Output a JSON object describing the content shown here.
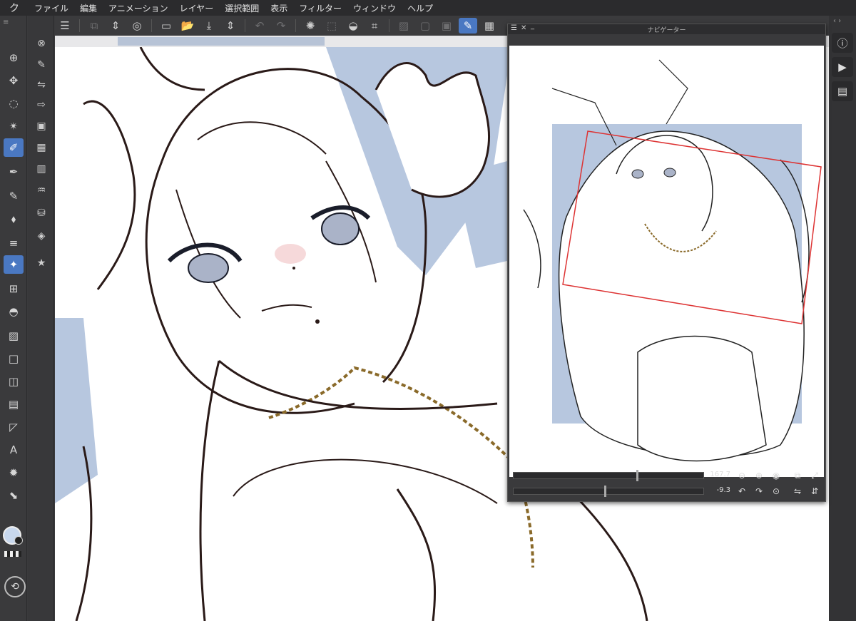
{
  "menubar": {
    "logo": "ク",
    "items": [
      "ファイル",
      "編集",
      "アニメーション",
      "レイヤー",
      "選択範囲",
      "表示",
      "フィルター",
      "ウィンドウ",
      "ヘルプ"
    ]
  },
  "toolbar": {
    "menu_icon": "☰",
    "new_icon": "⧉",
    "updown_icon": "⇕",
    "sync_icon": "◎",
    "doc_icon": "▭",
    "open_icon": "📂",
    "save_icon": "⤓",
    "undo_icon": "↶",
    "redo_icon": "↷",
    "spin_icon": "✺",
    "transform_icon": "⬚",
    "fill_icon": "◒",
    "crop_icon": "⌗",
    "a1": "▨",
    "a2": "▢",
    "a3": "▣",
    "pen_active": "✎",
    "grid_icon": "▦"
  },
  "tools": {
    "header": "≡",
    "items": [
      "⊕",
      "✥",
      "◌",
      "✴",
      "✐",
      "✒",
      "✎",
      "⬧",
      "≡",
      "✦",
      "⊞",
      "◓",
      "▨",
      "□",
      "◫",
      "▤",
      "◸",
      "A",
      "✹",
      "⬊"
    ],
    "rotate_icon": "⟲"
  },
  "subtools": {
    "items": [
      "⊗",
      "✎",
      "⇋",
      "⇨",
      "▣",
      "▦",
      "▥",
      "♒",
      "⛁",
      "◈",
      "★"
    ]
  },
  "rightbar": {
    "collapse": "‹ ›",
    "info_icon": "ⓘ",
    "anim_icon": "▶",
    "layer_icon": "▤"
  },
  "navigator": {
    "title": "ナビゲーター",
    "menu_icon": "☰",
    "close_icon": "✕",
    "min_icon": "_",
    "zoom_value": "167.7",
    "rotate_value": "-9.3",
    "zoom_out_icon": "⊖",
    "zoom_in_icon": "⊕",
    "fit_icon": "◉",
    "rot_left_icon": "↶",
    "rot_right_icon": "↷",
    "reset_icon": "⊙",
    "size_icon1": "⧉",
    "size_icon2": "⤢",
    "flip_h_icon": "⇋",
    "flip_v_icon": "⇵"
  }
}
